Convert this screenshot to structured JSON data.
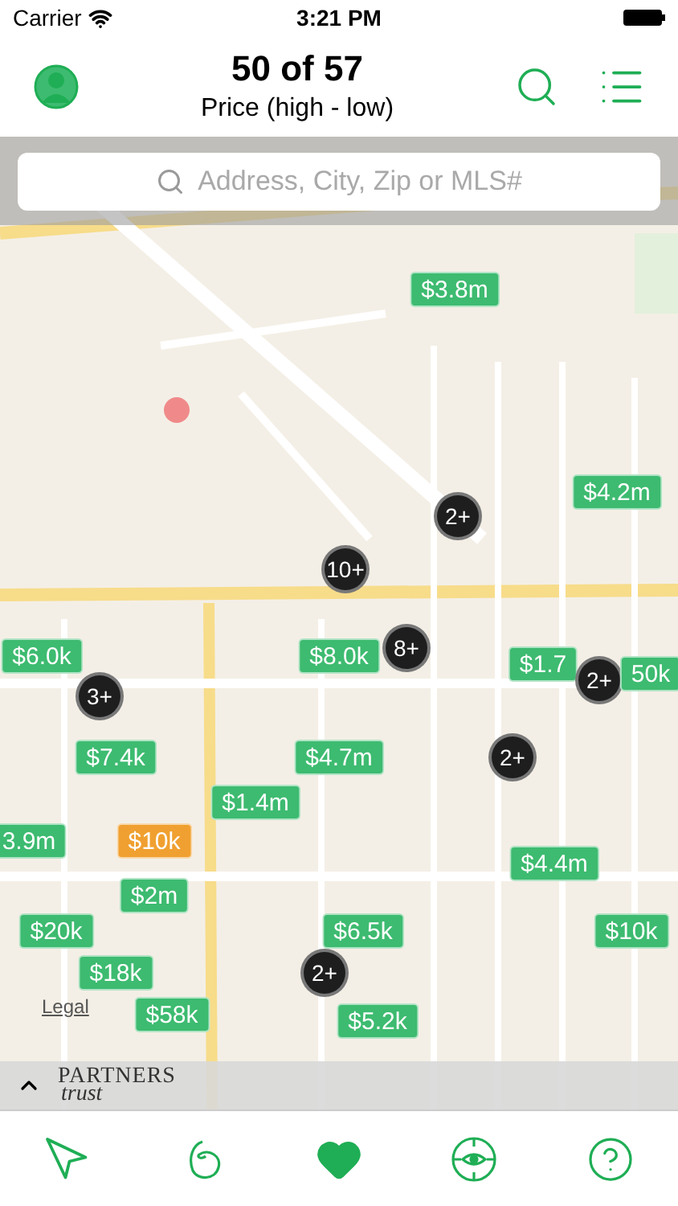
{
  "status_bar": {
    "carrier": "Carrier",
    "time": "3:21 PM"
  },
  "header": {
    "title": "50 of 57",
    "subtitle": "Price (high - low)"
  },
  "search": {
    "placeholder": "Address, City, Zip or MLS#"
  },
  "map": {
    "legal": "Legal",
    "markers": [
      {
        "kind": "price",
        "label": "$3.8m",
        "color": "#3dbb70"
      },
      {
        "kind": "cluster",
        "label": "2+"
      },
      {
        "kind": "price",
        "label": "$4.2m",
        "color": "#3dbb70"
      },
      {
        "kind": "cluster",
        "label": "10+"
      },
      {
        "kind": "price",
        "label": "$6.0k",
        "color": "#3dbb70"
      },
      {
        "kind": "cluster",
        "label": "3+"
      },
      {
        "kind": "price",
        "label": "$8.0k",
        "color": "#3dbb70"
      },
      {
        "kind": "cluster",
        "label": "8+"
      },
      {
        "kind": "price",
        "label": "$1.7",
        "color": "#3dbb70"
      },
      {
        "kind": "cluster",
        "label": "2+"
      },
      {
        "kind": "price",
        "label": "50k",
        "color": "#3dbb70"
      },
      {
        "kind": "price",
        "label": "$7.4k",
        "color": "#3dbb70"
      },
      {
        "kind": "price",
        "label": "$4.7m",
        "color": "#3dbb70"
      },
      {
        "kind": "cluster",
        "label": "2+"
      },
      {
        "kind": "price",
        "label": "$1.4m",
        "color": "#3dbb70"
      },
      {
        "kind": "price",
        "label": "3.9m",
        "color": "#3dbb70"
      },
      {
        "kind": "price",
        "label": "$10k",
        "color": "#f0a030"
      },
      {
        "kind": "price",
        "label": "$4.4m",
        "color": "#3dbb70"
      },
      {
        "kind": "price",
        "label": "$2m",
        "color": "#3dbb70"
      },
      {
        "kind": "price",
        "label": "$20k",
        "color": "#3dbb70"
      },
      {
        "kind": "price",
        "label": "$6.5k",
        "color": "#3dbb70"
      },
      {
        "kind": "price",
        "label": "$10k",
        "color": "#3dbb70"
      },
      {
        "kind": "price",
        "label": "$18k",
        "color": "#3dbb70"
      },
      {
        "kind": "cluster",
        "label": "2+"
      },
      {
        "kind": "price",
        "label": "$58k",
        "color": "#3dbb70"
      },
      {
        "kind": "price",
        "label": "$5.2k",
        "color": "#3dbb70"
      }
    ]
  },
  "brand": {
    "line_1": "PARTNERS",
    "line_2": "trust"
  },
  "tab_bar": [
    {
      "kind": "locate",
      "selected": false
    },
    {
      "kind": "lasso",
      "selected": false
    },
    {
      "kind": "favorites",
      "selected": true
    },
    {
      "kind": "view",
      "selected": false
    },
    {
      "kind": "help",
      "selected": false
    }
  ]
}
